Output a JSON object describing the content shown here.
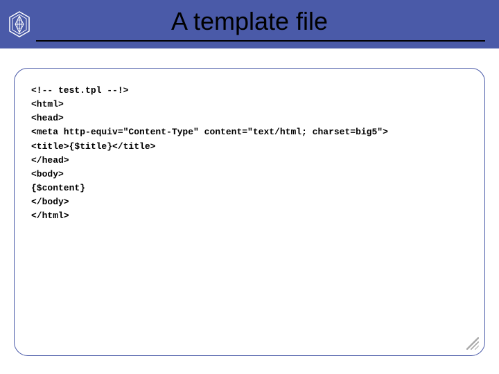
{
  "header": {
    "title": "A template file"
  },
  "code": {
    "lines": [
      "<!-- test.tpl --!>",
      "<html>",
      "<head>",
      "<meta http-equiv=\"Content-Type\" content=\"text/html; charset=big5\">",
      "<title>{$title}</title>",
      "</head>",
      "<body>",
      "{$content}",
      "</body>",
      "</html>"
    ]
  }
}
